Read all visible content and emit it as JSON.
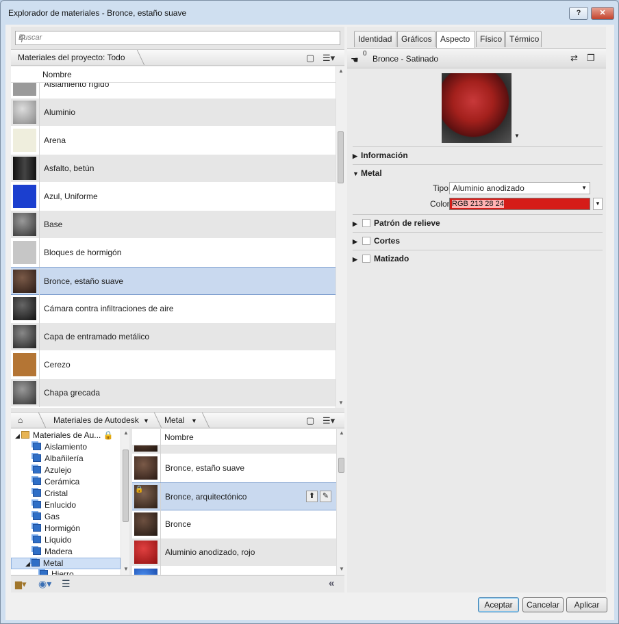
{
  "window": {
    "title": "Explorador de materiales - Bronce, estaño suave",
    "help_btn": "?",
    "close_btn": "✕"
  },
  "search": {
    "placeholder": "Buscar"
  },
  "project": {
    "crumb": "Materiales del proyecto: Todo",
    "column": "Nombre",
    "items": [
      {
        "label": "Aislamiento rígido",
        "color": "#9a9a9a"
      },
      {
        "label": "Aluminio",
        "color": "#b0b0b0"
      },
      {
        "label": "Arena",
        "color": "#efeedd"
      },
      {
        "label": "Asfalto, betún",
        "color": "#2b2b2b"
      },
      {
        "label": "Azul, Uniforme",
        "color": "#1b3fcf"
      },
      {
        "label": "Base",
        "color": "#6a6a6a"
      },
      {
        "label": "Bloques de hormigón",
        "color": "#c6c6c6"
      },
      {
        "label": "Bronce, estaño suave",
        "color": "#4a3328"
      },
      {
        "label": "Cámara contra infiltraciones de aire",
        "color": "#222222"
      },
      {
        "label": "Capa de entramado metálico",
        "color": "#5a5a5a"
      },
      {
        "label": "Cerezo",
        "color": "#b47534"
      },
      {
        "label": "Chapa grecada",
        "color": "#6b6b6b"
      }
    ]
  },
  "library": {
    "crumb_lib": "Materiales de Autodesk",
    "crumb_cat": "Metal",
    "column": "Nombre",
    "tree": [
      {
        "label": "Materiales de Au...",
        "level": 0
      },
      {
        "label": "Aislamiento",
        "level": 1
      },
      {
        "label": "Albañilería",
        "level": 1
      },
      {
        "label": "Azulejo",
        "level": 1
      },
      {
        "label": "Cerámica",
        "level": 1
      },
      {
        "label": "Cristal",
        "level": 1
      },
      {
        "label": "Enlucido",
        "level": 1
      },
      {
        "label": "Gas",
        "level": 1
      },
      {
        "label": "Hormigón",
        "level": 1
      },
      {
        "label": "Líquido",
        "level": 1
      },
      {
        "label": "Madera",
        "level": 1
      },
      {
        "label": "Metal",
        "level": 1
      },
      {
        "label": "Hierro",
        "level": 2
      }
    ],
    "items": [
      {
        "label": "",
        "color": "#3d2b22"
      },
      {
        "label": "Bronce, estaño suave",
        "color": "#4a3328"
      },
      {
        "label": "Bronce, arquitectónico",
        "color": "#4e3a2e"
      },
      {
        "label": "Bronce",
        "color": "#3f2d24"
      },
      {
        "label": "Aluminio anodizado, rojo",
        "color": "#c01a18"
      },
      {
        "label": "",
        "color": "#1f5fcf"
      }
    ]
  },
  "editor": {
    "tabs": [
      "Identidad",
      "Gráficos",
      "Aspecto",
      "Físico",
      "Térmico"
    ],
    "active_tab": "Aspecto",
    "asset_count": "0",
    "asset_name": "Bronce - Satinado",
    "sections": {
      "info": "Información",
      "metal": "Metal",
      "relief": "Patrón de relieve",
      "cuts": "Cortes",
      "tint": "Matizado"
    },
    "tipo_label": "Tipo",
    "tipo_value": "Aluminio anodizado",
    "color_label": "Color",
    "color_value": "RGB 213 28 24",
    "color_hex": "#d51c18"
  },
  "buttons": {
    "ok": "Aceptar",
    "cancel": "Cancelar",
    "apply": "Aplicar"
  }
}
